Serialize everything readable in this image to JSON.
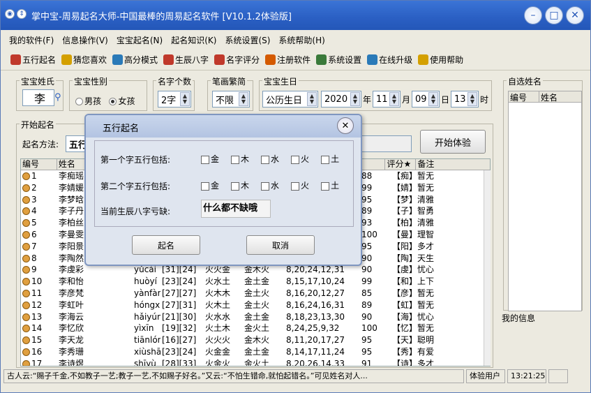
{
  "window": {
    "title": "掌中宝-周易起名大师-中国最棒的周易起名软件 [V10.1.2体验版]"
  },
  "menu": [
    "我的软件(F)",
    "信息操作(V)",
    "宝宝起名(N)",
    "起名知识(K)",
    "系统设置(S)",
    "系统帮助(H)"
  ],
  "toolbar": [
    {
      "label": "五行起名",
      "icon": "five-elements-icon",
      "color": "#c0392b"
    },
    {
      "label": "猜您喜欢",
      "icon": "star-icon",
      "color": "#d4a000"
    },
    {
      "label": "高分模式",
      "icon": "chart-icon",
      "color": "#2a7ab8"
    },
    {
      "label": "生辰八字",
      "icon": "calendar-icon",
      "color": "#c0392b"
    },
    {
      "label": "名字评分",
      "icon": "score-icon",
      "color": "#c0392b"
    },
    {
      "label": "注册软件",
      "icon": "gift-icon",
      "color": "#d45a00"
    },
    {
      "label": "系统设置",
      "icon": "settings-icon",
      "color": "#3a7a3a"
    },
    {
      "label": "在线升级",
      "icon": "globe-icon",
      "color": "#2a7ab8"
    },
    {
      "label": "使用帮助",
      "icon": "help-icon",
      "color": "#d4a000"
    }
  ],
  "form": {
    "surname_label": "宝宝姓氏",
    "surname": "李",
    "gender_label": "宝宝性别",
    "male": "男孩",
    "female": "女孩",
    "count_label": "名字个数",
    "count": "2字",
    "stroke_label": "笔画繁简",
    "stroke": "不限",
    "birth_label": "宝宝生日",
    "calendar": "公历生日",
    "year": "2020",
    "year_unit": "年",
    "month": "11",
    "month_unit": "月",
    "day": "09",
    "day_unit": "日",
    "hour": "13",
    "hour_unit": "时",
    "start_label": "开始起名",
    "method_label": "起名方法:",
    "method": "五行",
    "start_button": "开始体验"
  },
  "table": {
    "headers": [
      "编号",
      "姓名",
      "评分★",
      "备注"
    ],
    "rows": [
      {
        "no": "1",
        "name": "李痴瑶",
        "py": "",
        "br": "",
        "wx": "",
        "sx": "",
        "nums": "40",
        "score": "88",
        "note": "【痴】暂无"
      },
      {
        "no": "2",
        "name": "李婧媛",
        "py": "",
        "br": "",
        "wx": "",
        "sx": "",
        "nums": "29",
        "score": "99",
        "note": "【婧】暂无"
      },
      {
        "no": "3",
        "name": "李梦晗",
        "py": "",
        "br": "",
        "wx": "",
        "sx": "",
        "nums": "34",
        "score": "95",
        "note": "【梦】清雅"
      },
      {
        "no": "4",
        "name": "李子丹",
        "py": "",
        "br": "",
        "wx": "",
        "sx": "",
        "nums": "",
        "score": "89",
        "note": "【子】智勇"
      },
      {
        "no": "5",
        "name": "李柏丝",
        "py": "",
        "br": "",
        "wx": "",
        "sx": "",
        "nums": "30",
        "score": "93",
        "note": "【柏】清雅"
      },
      {
        "no": "6",
        "name": "李曼雯",
        "py": "",
        "br": "",
        "wx": "",
        "sx": "",
        "nums": "30",
        "score": "100",
        "note": "【曼】理智"
      },
      {
        "no": "7",
        "name": "李阳景",
        "py": "",
        "br": "",
        "wx": "",
        "sx": "",
        "nums": "36",
        "score": "95",
        "note": "【阳】多才"
      },
      {
        "no": "8",
        "name": "李陶然",
        "py": "",
        "br": "",
        "wx": "",
        "sx": "",
        "nums": "35",
        "score": "90",
        "note": "【陶】天生"
      },
      {
        "no": "9",
        "name": "李虔彩",
        "py": "yǔcái",
        "br": "[31][24]",
        "wx": "火火金",
        "sx": "金木火",
        "nums": "8,20,24,12,31",
        "score": "90",
        "note": "【虔】忧心"
      },
      {
        "no": "10",
        "name": "李和怡",
        "py": "huòyí",
        "br": "[23][24]",
        "wx": "火水土",
        "sx": "金土金",
        "nums": "8,15,17,10,24",
        "score": "99",
        "note": "【和】上下"
      },
      {
        "no": "11",
        "name": "李彦梵",
        "py": "yànfàn",
        "br": "[27][27]",
        "wx": "火木木",
        "sx": "金土火",
        "nums": "8,16,20,12,27",
        "score": "85",
        "note": "【彦】暂无"
      },
      {
        "no": "12",
        "name": "李虹叶",
        "py": "hóngxié",
        "br": "[27][31]",
        "wx": "火木土",
        "sx": "金土火",
        "nums": "8,16,24,16,31",
        "score": "89",
        "note": "【虹】暂无"
      },
      {
        "no": "13",
        "name": "李海云",
        "py": "hǎiyún",
        "br": "[21][30]",
        "wx": "火水水",
        "sx": "金土金",
        "nums": "8,18,23,13,30",
        "score": "90",
        "note": "【海】忧心"
      },
      {
        "no": "14",
        "name": "李忆欣",
        "py": "yìxīn",
        "br": "[19][32]",
        "wx": "火土木",
        "sx": "金火土",
        "nums": "8,24,25,9,32",
        "score": "100",
        "note": "【忆】暂无"
      },
      {
        "no": "15",
        "name": "李天龙",
        "py": "tiānlóng",
        "br": "[16][27]",
        "wx": "火火火",
        "sx": "金木火",
        "nums": "8,11,20,17,27",
        "score": "95",
        "note": "【天】聪明"
      },
      {
        "no": "16",
        "name": "李秀珊",
        "py": "xiùshān",
        "br": "[23][24]",
        "wx": "火金金",
        "sx": "金土金",
        "nums": "8,14,17,11,24",
        "score": "95",
        "note": "【秀】有爱"
      },
      {
        "no": "17",
        "name": "李诗煜",
        "py": "shīyù",
        "br": "[28][33]",
        "wx": "火金火",
        "sx": "金火土",
        "nums": "8,20,26,14,33",
        "score": "91",
        "note": "【诗】多才"
      }
    ]
  },
  "right": {
    "favorites_label": "自选姓名",
    "col_no": "编号",
    "col_name": "姓名",
    "myinfo_label": "我的信息"
  },
  "dialog": {
    "title": "五行起名",
    "row1": "第一个字五行包括:",
    "row2": "第二个字五行包括:",
    "row3": "当前生辰八字亏缺:",
    "elements": [
      "金",
      "木",
      "水",
      "火",
      "土"
    ],
    "lack": "什么都不缺哦",
    "ok": "起名",
    "cancel": "取消"
  },
  "status": {
    "quote": "古人云:“赐子千金,不如教子一艺;教子一艺,不如赐子好名。”又云:“不怕生错命,就怕起错名。”可见姓名对人...",
    "user": "体验用户",
    "time": "13:21:25"
  }
}
